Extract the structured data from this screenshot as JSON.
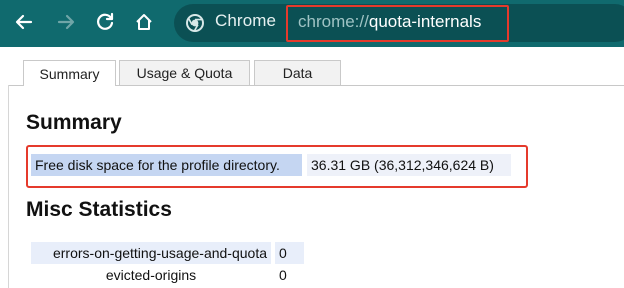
{
  "toolbar": {
    "back_icon": "arrow-left",
    "forward_icon": "arrow-right",
    "reload_icon": "reload",
    "home_icon": "home",
    "chip_label": "Chrome",
    "url_scheme": "chrome://",
    "url_host": "quota-internals"
  },
  "tabs": [
    {
      "label": "Summary",
      "active": true
    },
    {
      "label": "Usage & Quota",
      "active": false
    },
    {
      "label": "Data",
      "active": false
    }
  ],
  "summary": {
    "heading": "Summary",
    "free_disk_label": "Free disk space for the profile directory.",
    "free_disk_value": "36.31 GB (36,312,346,624 B)"
  },
  "misc": {
    "heading": "Misc Statistics",
    "rows": [
      {
        "name": "errors-on-getting-usage-and-quota",
        "value": "0"
      },
      {
        "name": "evicted-origins",
        "value": "0"
      }
    ]
  },
  "colors": {
    "toolbar": "#106a6e",
    "omnibox": "#0b5054",
    "highlight_frame": "#e53a2c"
  }
}
